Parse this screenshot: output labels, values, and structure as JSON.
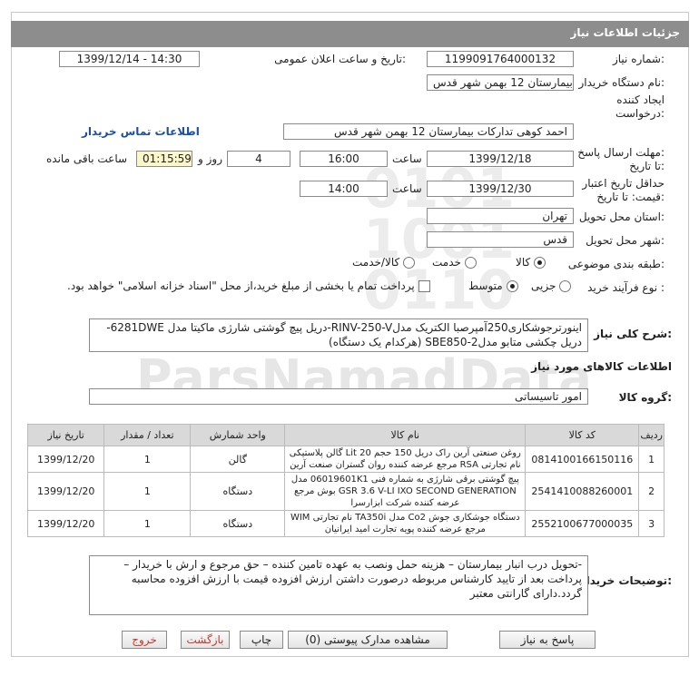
{
  "window": {
    "title": "جزئیات اطلاعات نیاز"
  },
  "watermark": {
    "text": "ParsNamadData"
  },
  "form": {
    "need_number": {
      "label": "شماره نیاز:",
      "value": "1199091764000132"
    },
    "announce_datetime": {
      "label": "تاریخ و ساعت اعلان عمومی:",
      "value": "1399/12/14 - 14:30"
    },
    "buyer_org": {
      "label": "نام دستگاه خریدار:",
      "value": "بیمارستان 12 بهمن شهر قدس"
    },
    "requester": {
      "label_line1": "ایجاد کننده",
      "label_line2": "درخواست:",
      "value": "احمد کوهی تدارکات بیمارستان 12 بهمن شهر قدس",
      "contact_link": "اطلاعات تماس خریدار"
    },
    "reply_deadline": {
      "label_line1": "مهلت ارسال پاسخ:",
      "label_line2": "تا تاریخ:",
      "date": "1399/12/18",
      "time_label": "ساعت",
      "time": "16:00",
      "days": "4",
      "days_label": "روز و",
      "remaining": "01:15:59",
      "remaining_label": "ساعت باقی مانده"
    },
    "price_validity": {
      "label_line1": "حداقل تاریخ اعتبار",
      "label_line2": "قیمت: تا تاریخ:",
      "date": "1399/12/30",
      "time_label": "ساعت",
      "time": "14:00"
    },
    "province": {
      "label": "استان محل تحویل:",
      "value": "تهران"
    },
    "city": {
      "label": "شهر محل تحویل:",
      "value": "قدس"
    },
    "category": {
      "label": "طبقه بندی موضوعی:",
      "options": [
        "کالا",
        "خدمت",
        "کالا/خدمت"
      ],
      "selected": "کالا"
    },
    "purchase_type": {
      "label": "نوع فرآیند خرید :",
      "options": [
        "جزیی",
        "متوسط"
      ],
      "selected": "متوسط",
      "payment_note": "پرداخت تمام یا بخشی از مبلغ خرید،از محل \"اسناد خزانه اسلامی\" خواهد بود."
    }
  },
  "general_description": {
    "label": "شرح کلی نیاز:",
    "text": "اینورترجوشکاری250آمپرصبا الکتریک مدلRINV-250-V-دریل پیچ گوشتی شارژی ماکیتا مدل 6281DWE-دریل چکشی متابو مدلSBE850-2 (هرکدام یک دستگاه)"
  },
  "goods_section": {
    "title": "اطلاعات کالاهای مورد نیاز",
    "group_label": "گروه کالا:",
    "group_value": "امور تاسیساتی",
    "columns": [
      "ردیف",
      "کد کالا",
      "نام کالا",
      "واحد شمارش",
      "تعداد / مقدار",
      "تاریخ نیاز"
    ],
    "rows": [
      {
        "row": "1",
        "code": "0814100166150116",
        "name": "روغن صنعتی آرین راک دریل 150 حجم 20 Lit گالن پلاستیکی نام تجارتی RSA مرجع عرضه کننده روان گستران صنعت آرین",
        "unit": "گالن",
        "qty": "1",
        "date": "1399/12/20"
      },
      {
        "row": "2",
        "code": "2541410088260001",
        "name": "پیچ گوشتی برقی شارژی به شماره فنی 06019601K1 مدل GSR 3.6 V-LI IXO SECOND GENERATION بوش مرجع عرضه کننده شرکت ابزارسرا",
        "unit": "دستگاه",
        "qty": "1",
        "date": "1399/12/20"
      },
      {
        "row": "3",
        "code": "2552100677000035",
        "name": "دستگاه جوشکاری جوش Co2 مدل TA350i نام تجارتی WIM مرجع عرضه کننده پویه تجارت امید ایرانیان",
        "unit": "دستگاه",
        "qty": "1",
        "date": "1399/12/20"
      }
    ]
  },
  "buyer_notes": {
    "label": "توضیحات خریدار:",
    "text": "-تحویل درب انبار بیمارستان – هزینه حمل ونصب به عهده تامین کننده – حق مرجوع و ارش با خریدار – پرداخت بعد از تایید کارشناس مربوطه درصورت داشتن ارزش افزوده قیمت با ارزش افزوده محاسبه گردد.دارای گارانتی معتبر"
  },
  "actions": {
    "reply": "پاسخ به نیاز",
    "attachments": "مشاهده مدارک پیوستی (0)",
    "print": "چاپ",
    "back": "بازگشت",
    "exit": "خروج"
  },
  "colors": {
    "titlebar": "#8d8d8d",
    "link": "#1a4fa3",
    "timer_bg": "#fbf7c8",
    "exit_text": "#c0392b"
  }
}
